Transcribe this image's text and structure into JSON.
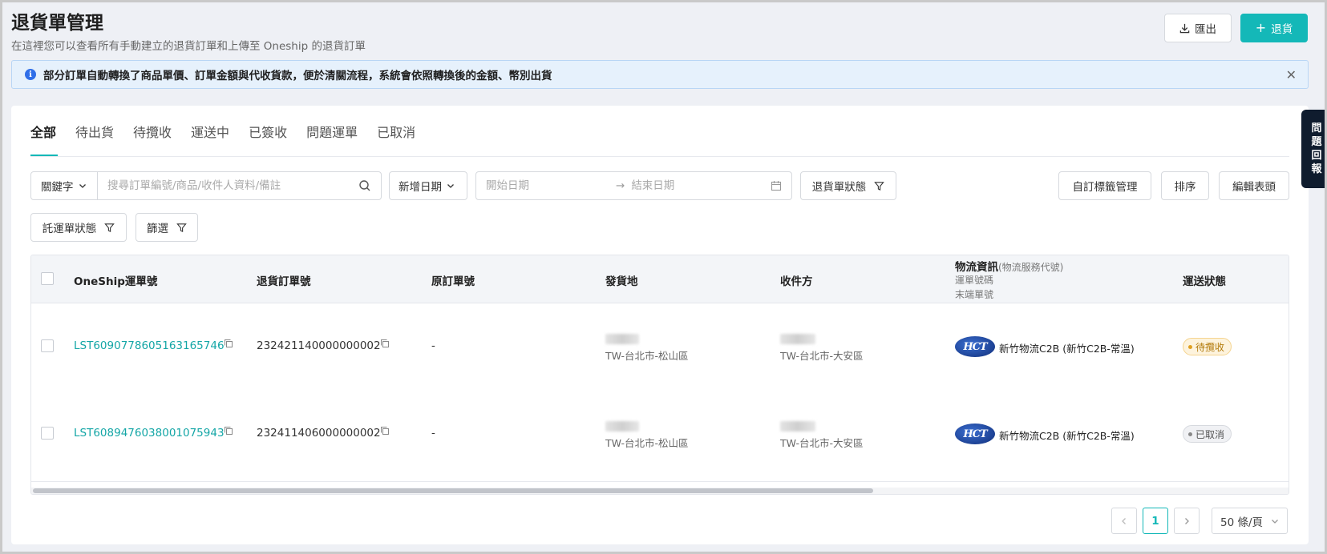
{
  "header": {
    "title": "退貨單管理",
    "subtitle": "在這裡您可以查看所有手動建立的退貨訂單和上傳至 Oneship 的退貨訂單",
    "export_label": "匯出",
    "create_label": "退貨"
  },
  "alert": {
    "text": "部分訂單自動轉換了商品單價、訂單金額與代收貨款，便於清關流程，系統會依照轉換後的金額、幣別出貨"
  },
  "tabs": [
    "全部",
    "待出貨",
    "待攬收",
    "運送中",
    "已簽收",
    "問題運單",
    "已取消"
  ],
  "filters": {
    "keyword_select": "關鍵字",
    "search_placeholder": "搜尋訂單編號/商品/收件人資料/備註",
    "date_select": "新增日期",
    "start_date_placeholder": "開始日期",
    "end_date_placeholder": "結束日期",
    "return_status": "退貨單狀態",
    "tag_manage": "自訂標籤管理",
    "sort": "排序",
    "edit_columns": "編輯表頭",
    "shipment_status": "託運單狀態",
    "filter": "篩選"
  },
  "table": {
    "columns": {
      "oneship_no": "OneShip運單號",
      "return_no": "退貨訂單號",
      "original_no": "原訂單號",
      "origin": "發貨地",
      "recipient": "收件方",
      "logistics": "物流資訊",
      "logistics_code": "(物流服務代號)",
      "tracking_code": "運單號碼",
      "last_mile": "末端單號",
      "delivery_status": "運送狀態"
    },
    "rows": [
      {
        "oneship_no": "LST6090778605163165746",
        "return_no": "232421140000000002",
        "original_no": "-",
        "origin_location": "TW-台北市-松山區",
        "recipient_location": "TW-台北市-大安區",
        "logo_text": "HCT",
        "logistics_name": "新竹物流C2B (新竹C2B-常溫)",
        "status": "待攬收"
      },
      {
        "oneship_no": "LST6089476038001075943",
        "return_no": "232411406000000002",
        "original_no": "-",
        "origin_location": "TW-台北市-松山區",
        "recipient_location": "TW-台北市-大安區",
        "logo_text": "HCT",
        "logistics_name": "新竹物流C2B (新竹C2B-常溫)",
        "status": "已取消"
      }
    ]
  },
  "pagination": {
    "current_page": "1",
    "page_size": "50 條/頁"
  },
  "side_feedback": [
    "問",
    "題",
    "回",
    "報"
  ],
  "colors": {
    "accent": "#14b8b8",
    "link": "#14a6a6",
    "alert_bg": "#e6f1fc",
    "status_waiting": "#b27a0a",
    "status_cancelled": "#555555"
  }
}
